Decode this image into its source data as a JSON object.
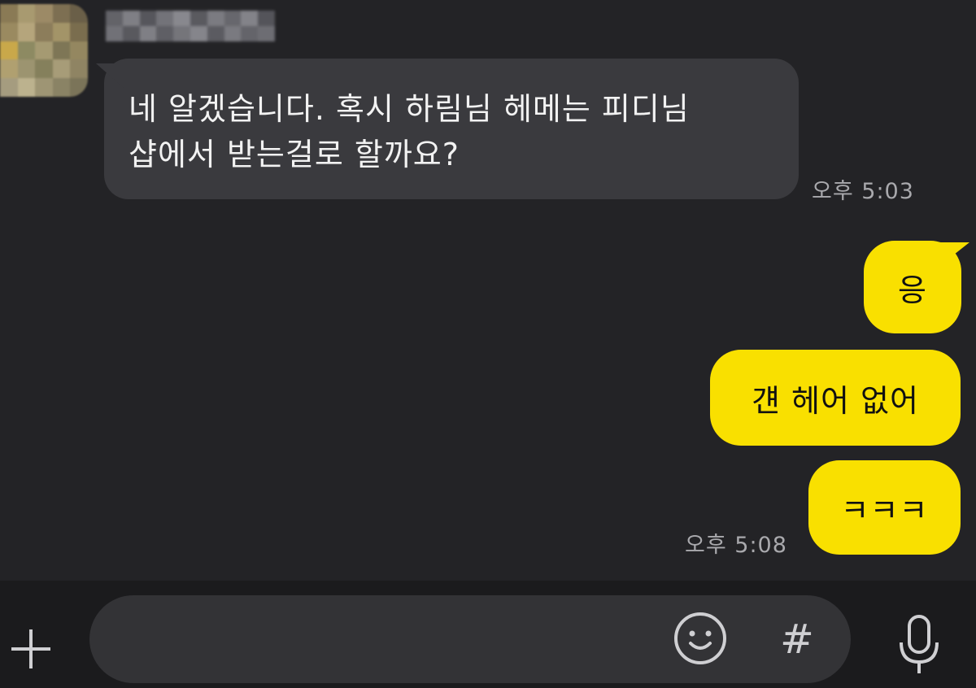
{
  "conversation": {
    "incoming": {
      "lines": [
        "네 알겠습니다. 혹시 하림님 헤메는 피디님",
        "샵에서 받는걸로 할까요?"
      ],
      "time": "오후 5:03"
    },
    "outgoing": [
      {
        "text": "응"
      },
      {
        "text": "걘 헤어 없어"
      },
      {
        "text": "ㅋㅋㅋ"
      }
    ],
    "outgoing_time": "오후 5:08"
  },
  "input_bar": {
    "placeholder": "",
    "plus_icon": "plus-icon",
    "emoji_icon": "emoji-icon",
    "hash_label": "#",
    "mic_icon": "microphone-icon"
  },
  "colors": {
    "background": "#232326",
    "incoming_bubble": "#3a3a3e",
    "outgoing_bubble": "#f9e000",
    "input_bar": "#1b1b1d"
  }
}
